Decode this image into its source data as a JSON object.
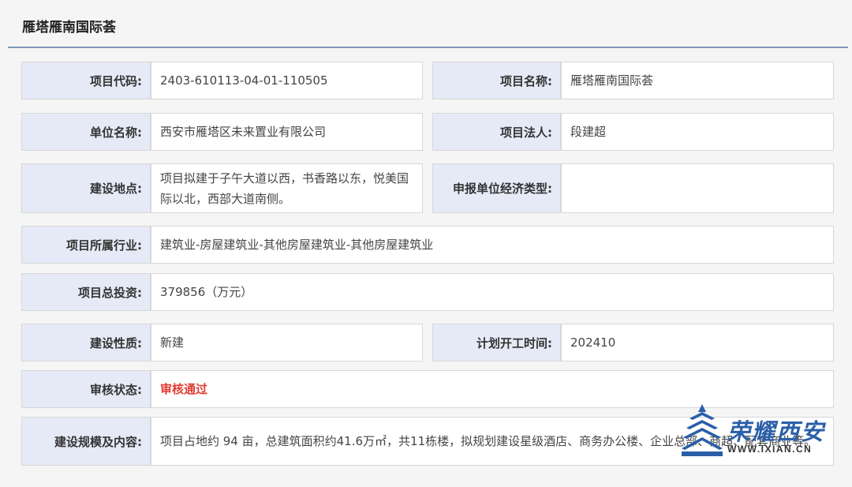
{
  "title": "雁塔雁南国际荟",
  "rows": {
    "r1": {
      "l1": "项目代码:",
      "v1": "2403-610113-04-01-110505",
      "l2": "项目名称:",
      "v2": "雁塔雁南国际荟"
    },
    "r2": {
      "l1": "单位名称:",
      "v1": "西安市雁塔区未来置业有限公司",
      "l2": "项目法人:",
      "v2": "段建超"
    },
    "r3": {
      "l1": "建设地点:",
      "v1": "项目拟建于子午大道以西，书香路以东，悦美国际以北，西部大道南侧。",
      "l2": "申报单位经济类型:",
      "v2": ""
    },
    "r4": {
      "l1": "项目所属行业:",
      "v1": "建筑业-房屋建筑业-其他房屋建筑业-其他房屋建筑业"
    },
    "r5": {
      "l1": "项目总投资:",
      "v1": "379856（万元）"
    },
    "r6": {
      "l1": "建设性质:",
      "v1": "新建",
      "l2": "计划开工时间:",
      "v2": "202410"
    },
    "r7": {
      "l1": "审核状态:",
      "v1": "审核通过"
    },
    "r8": {
      "l1": "建设规模及内容:",
      "v1": "项目占地约 94 亩，总建筑面积约41.6万㎡，共11栋楼，拟规划建设星级酒店、商务办公楼、企业总部、商超、配套商业等。"
    }
  },
  "watermark": {
    "text": "荣耀西安",
    "url": "WWW.IXIAN.CN"
  },
  "colors": {
    "label_bg": "#e6eaf7",
    "status_red": "#e03a2f",
    "brand_blue": "#2a5fa8"
  }
}
